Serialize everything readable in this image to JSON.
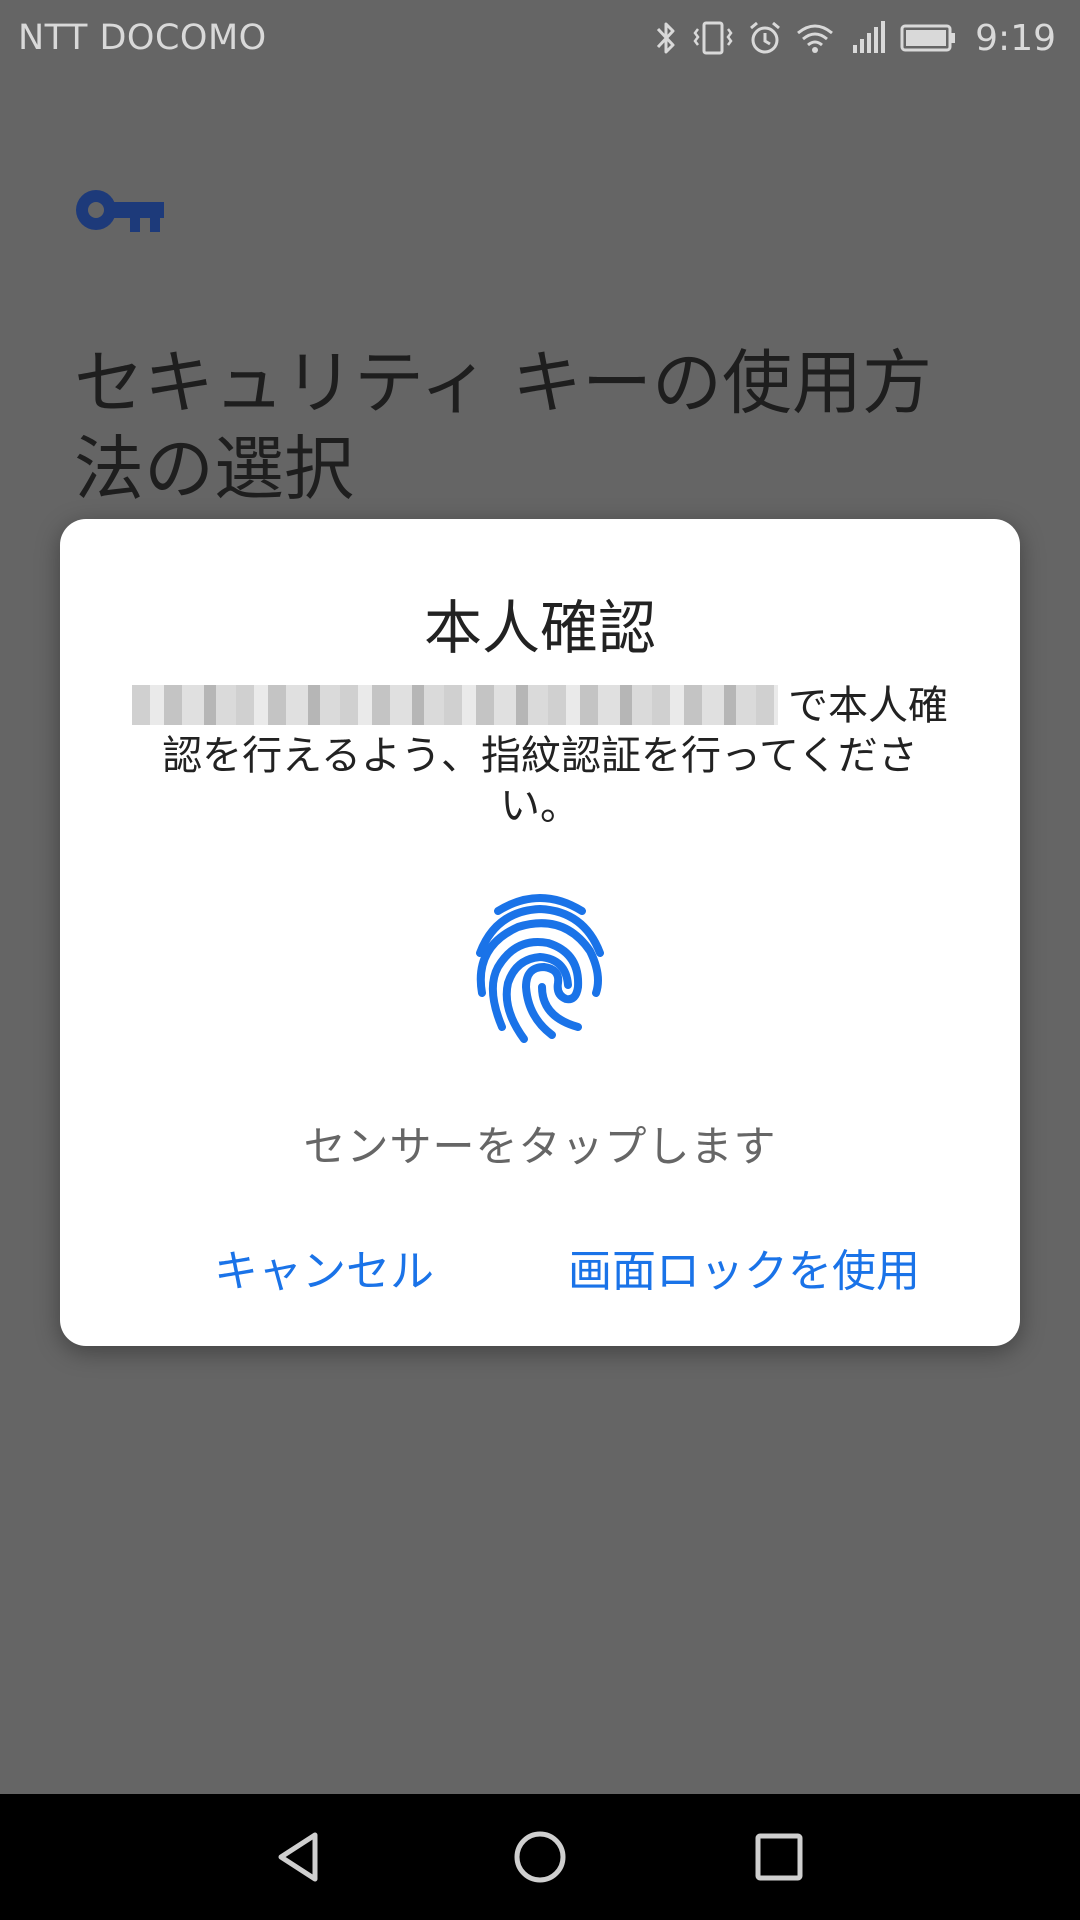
{
  "status_bar": {
    "carrier": "NTT DOCOMO",
    "time": "9:19",
    "icons": [
      "bluetooth-icon",
      "vibrate-icon",
      "alarm-icon",
      "wifi-icon",
      "signal-icon",
      "battery-icon"
    ]
  },
  "page": {
    "icon": "key-icon",
    "title": "セキュリティ キーの使用方法の選択"
  },
  "dialog": {
    "title": "本人確認",
    "message": "で本人確認を行えるよう、指紋認証を行ってください。",
    "icon": "fingerprint-icon",
    "hint": "センサーをタップします",
    "cancel_label": "キャンセル",
    "screen_lock_label": "画面ロックを使用"
  },
  "nav_bar": {
    "icons": [
      "back-icon",
      "home-icon",
      "recent-apps-icon"
    ]
  },
  "colors": {
    "accent": "#1a73e8",
    "scrim_background": "#656565",
    "key_icon": "#1d3a7a"
  }
}
